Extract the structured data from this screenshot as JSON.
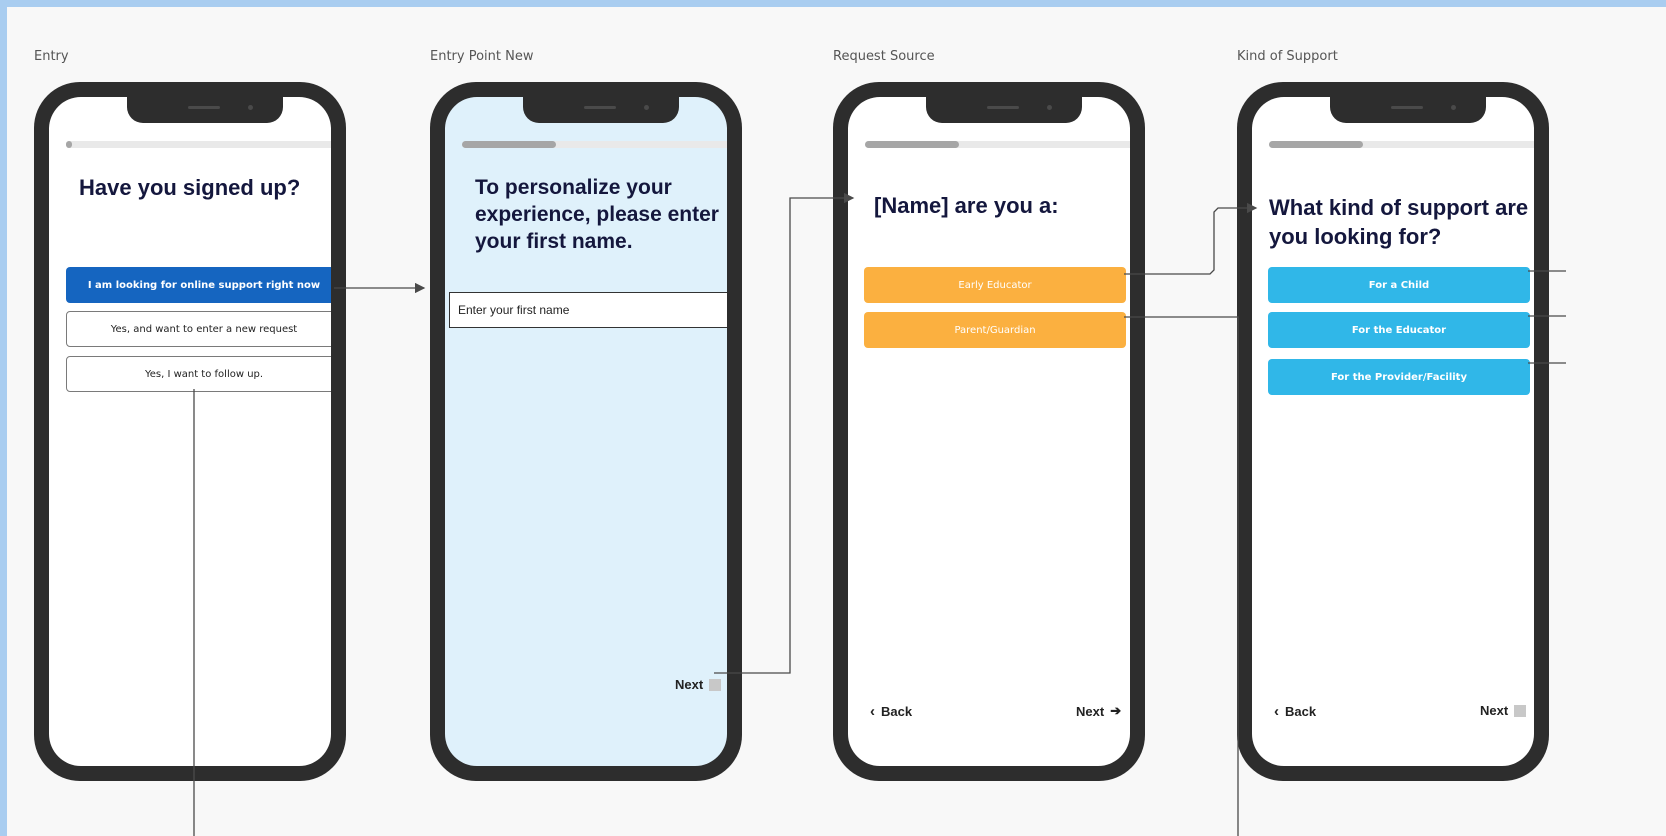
{
  "frames": [
    {
      "title": "Entry",
      "heading": "Have you signed up?",
      "progress": 0.02,
      "options": [
        "I am looking for online support right now",
        "Yes, and want to enter a new request",
        "Yes, I want to follow up."
      ]
    },
    {
      "title": "Entry Point New",
      "heading": "To personalize your experience, please enter your first name.",
      "progress": 0.34,
      "input_placeholder": "Enter your first name",
      "next_label": "Next"
    },
    {
      "title": "Request Source",
      "heading": "[Name] are you a:",
      "progress": 0.34,
      "options": [
        "Early Educator",
        "Parent/Guardian"
      ],
      "back_label": "Back",
      "next_label": "Next"
    },
    {
      "title": "Kind of Support",
      "heading": "What kind of support are you looking for?",
      "progress": 0.34,
      "options": [
        "For a Child",
        "For the Educator",
        "For the Provider/Facility"
      ],
      "back_label": "Back",
      "next_label": "Next"
    }
  ],
  "colors": {
    "background": "#a9cdf0",
    "canvas": "#f8f8f8",
    "phone_bezel": "#2d2d2d",
    "heading": "#14173d",
    "primary_button": "#1565c0",
    "orange_option": "#fbb040",
    "blue_option": "#30b7e8",
    "light_screen": "#dff1fb",
    "connector": "#4a4a4a"
  },
  "icons": {
    "back": "chevron-left-icon",
    "next_arrow": "arrow-right-icon",
    "next_placeholder": "grey-square-icon"
  }
}
